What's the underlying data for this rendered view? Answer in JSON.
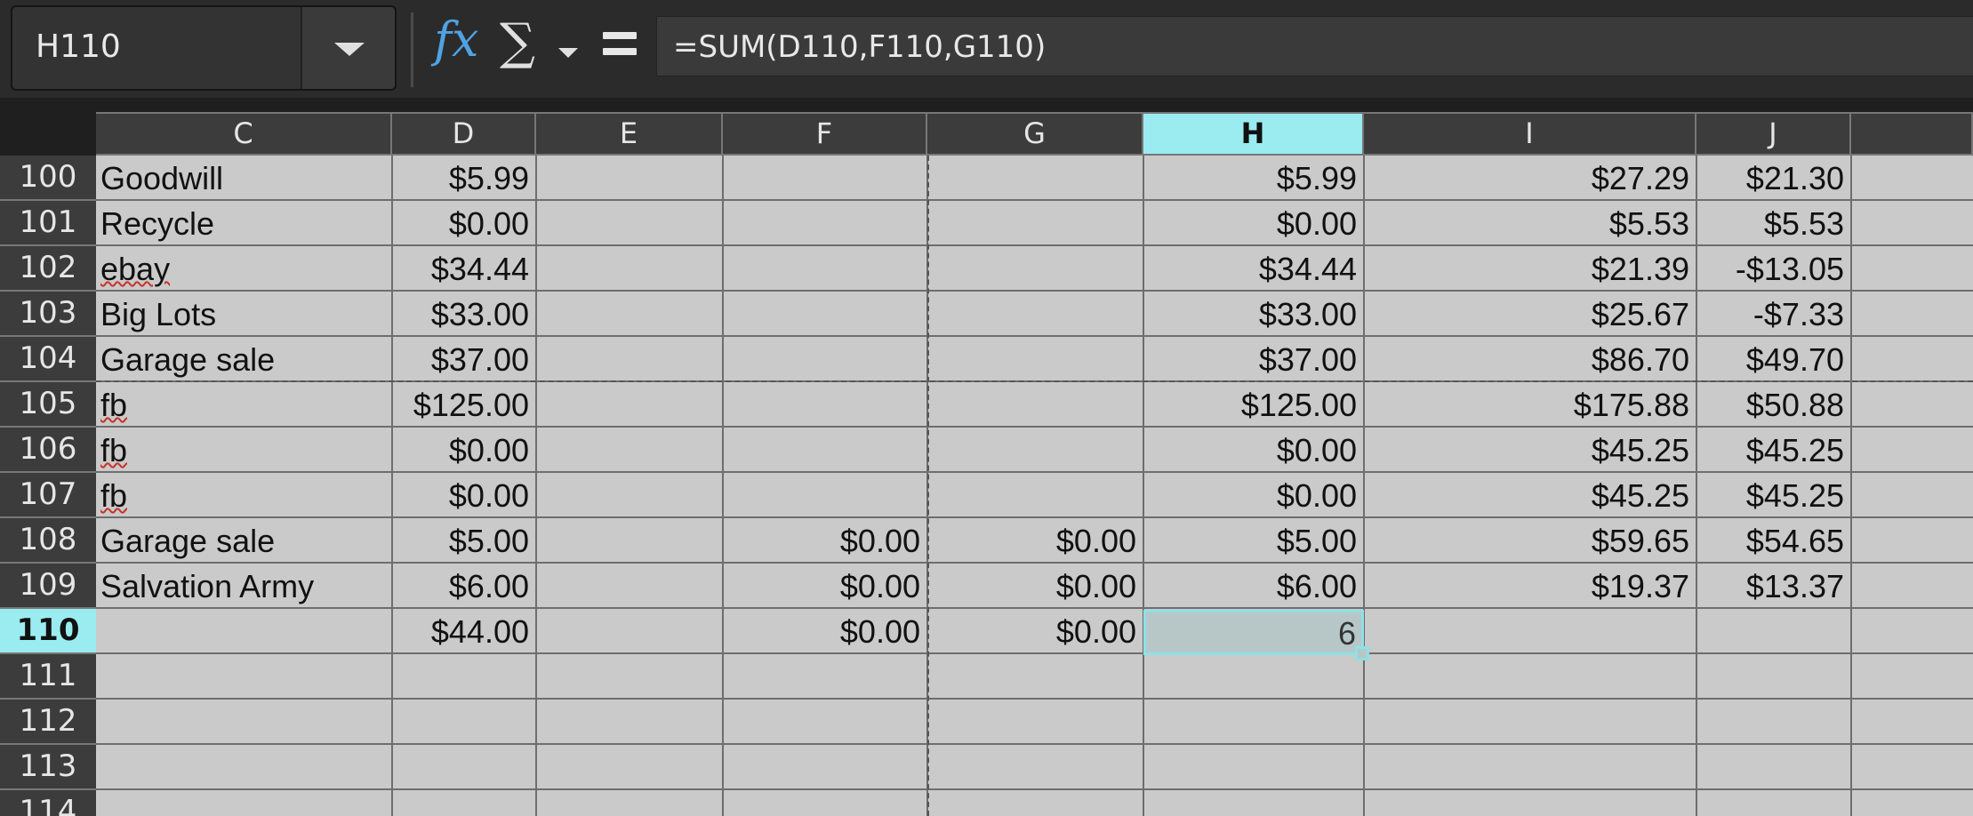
{
  "name_box": {
    "value": "H110"
  },
  "toolbar": {
    "fx_label": "fx",
    "sum_label": "∑"
  },
  "formula_bar": {
    "value": "=SUM(D110,F110,G110)"
  },
  "columns": [
    "C",
    "D",
    "E",
    "F",
    "G",
    "H",
    "I",
    "J"
  ],
  "selected_column": "H",
  "selected_row": "110",
  "rows": [
    {
      "num": "100",
      "C": "Goodwill",
      "D": "$5.99",
      "F": "",
      "G": "",
      "H": "$5.99",
      "I": "$27.29",
      "J": "$21.30"
    },
    {
      "num": "101",
      "C": "Recycle",
      "D": "$0.00",
      "F": "",
      "G": "",
      "H": "$0.00",
      "I": "$5.53",
      "J": "$5.53"
    },
    {
      "num": "102",
      "C": "ebay",
      "D": "$34.44",
      "F": "",
      "G": "",
      "H": "$34.44",
      "I": "$21.39",
      "J": "-$13.05"
    },
    {
      "num": "103",
      "C": "Big Lots",
      "D": "$33.00",
      "F": "",
      "G": "",
      "H": "$33.00",
      "I": "$25.67",
      "J": "-$7.33"
    },
    {
      "num": "104",
      "C": "Garage sale",
      "D": "$37.00",
      "F": "",
      "G": "",
      "H": "$37.00",
      "I": "$86.70",
      "J": "$49.70"
    },
    {
      "num": "105",
      "C": "fb",
      "D": "$125.00",
      "F": "",
      "G": "",
      "H": "$125.00",
      "I": "$175.88",
      "J": "$50.88"
    },
    {
      "num": "106",
      "C": "fb",
      "D": "$0.00",
      "F": "",
      "G": "",
      "H": "$0.00",
      "I": "$45.25",
      "J": "$45.25"
    },
    {
      "num": "107",
      "C": "fb",
      "D": "$0.00",
      "F": "",
      "G": "",
      "H": "$0.00",
      "I": "$45.25",
      "J": "$45.25"
    },
    {
      "num": "108",
      "C": "Garage sale",
      "D": "$5.00",
      "F": "$0.00",
      "G": "$0.00",
      "H": "$5.00",
      "I": "$59.65",
      "J": "$54.65"
    },
    {
      "num": "109",
      "C": "Salvation Army",
      "D": "$6.00",
      "F": "$0.00",
      "G": "$0.00",
      "H": "$6.00",
      "I": "$19.37",
      "J": "$13.37"
    },
    {
      "num": "110",
      "C": "",
      "D": "$44.00",
      "F": "$0.00",
      "G": "$0.00",
      "H": "6",
      "I": "",
      "J": ""
    },
    {
      "num": "111",
      "C": "",
      "D": "",
      "F": "",
      "G": "",
      "H": "",
      "I": "",
      "J": ""
    },
    {
      "num": "112",
      "C": "",
      "D": "",
      "F": "",
      "G": "",
      "H": "",
      "I": "",
      "J": ""
    },
    {
      "num": "113",
      "C": "",
      "D": "",
      "F": "",
      "G": "",
      "H": "",
      "I": "",
      "J": ""
    },
    {
      "num": "114",
      "C": "",
      "D": "",
      "F": "",
      "G": "",
      "H": "",
      "I": "",
      "J": ""
    }
  ],
  "active_cell": {
    "value": "6"
  },
  "spellcheck_flagged": [
    "ebay",
    "fb"
  ],
  "colors": {
    "selection_header": "#9aecf0",
    "selection_border": "#8ee1e6",
    "fx_icon": "#4fa3e3",
    "spell_error": "#c8322a"
  }
}
